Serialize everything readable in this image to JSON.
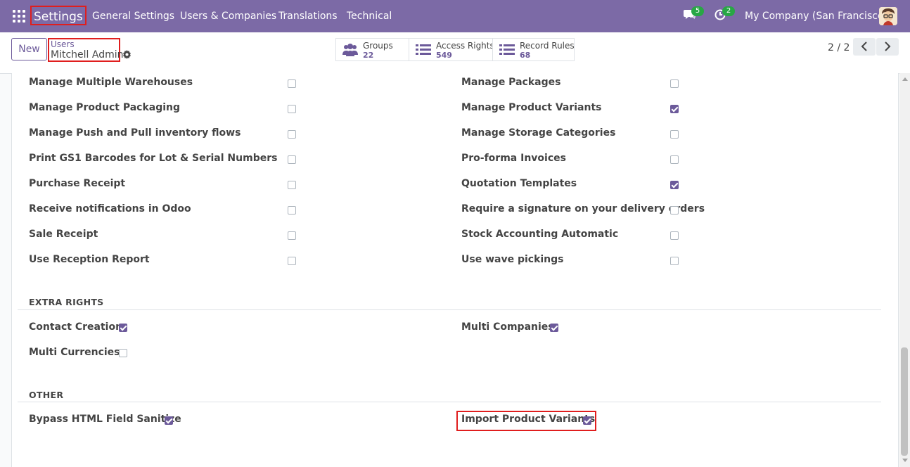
{
  "navbar": {
    "brand": "Settings",
    "menu": [
      "General Settings",
      "Users & Companies",
      "Translations",
      "Technical"
    ],
    "messages_count": "5",
    "activities_count": "2",
    "company": "My Company (San Francisco)"
  },
  "control": {
    "new_label": "New",
    "breadcrumb_parent": "Users",
    "breadcrumb_current": "Mitchell Admin",
    "stats": [
      {
        "label": "Groups",
        "value": "22"
      },
      {
        "label": "Access Rights",
        "value": "549"
      },
      {
        "label": "Record Rules",
        "value": "68"
      }
    ],
    "pager": "2 / 2"
  },
  "rights_left": [
    {
      "label": "Manage Multiple Warehouses",
      "checked": false
    },
    {
      "label": "Manage Product Packaging",
      "checked": false
    },
    {
      "label": "Manage Push and Pull inventory flows",
      "checked": false
    },
    {
      "label": "Print GS1 Barcodes for Lot & Serial Numbers",
      "checked": false
    },
    {
      "label": "Purchase Receipt",
      "checked": false
    },
    {
      "label": "Receive notifications in Odoo",
      "checked": false
    },
    {
      "label": "Sale Receipt",
      "checked": false
    },
    {
      "label": "Use Reception Report",
      "checked": false
    }
  ],
  "rights_right": [
    {
      "label": "Manage Packages",
      "checked": false
    },
    {
      "label": "Manage Product Variants",
      "checked": true
    },
    {
      "label": "Manage Storage Categories",
      "checked": false
    },
    {
      "label": "Pro-forma Invoices",
      "checked": false
    },
    {
      "label": "Quotation Templates",
      "checked": true
    },
    {
      "label": "Require a signature on your delivery orders",
      "checked": false
    },
    {
      "label": "Stock Accounting Automatic",
      "checked": false
    },
    {
      "label": "Use wave pickings",
      "checked": false
    }
  ],
  "extra_rights": {
    "title": "EXTRA RIGHTS",
    "items": [
      {
        "label": "Contact Creation",
        "checked": true
      },
      {
        "label": "Multi Companies",
        "checked": true
      },
      {
        "label": "Multi Currencies",
        "checked": false
      }
    ]
  },
  "other": {
    "title": "OTHER",
    "items": [
      {
        "label": "Bypass HTML Field Sanitize",
        "checked": true
      },
      {
        "label": "Import Product Variants",
        "checked": true
      }
    ]
  },
  "colors": {
    "navbar": "#7c6aa6",
    "accent": "#6c5a9a",
    "highlight": "#e01e1e"
  }
}
